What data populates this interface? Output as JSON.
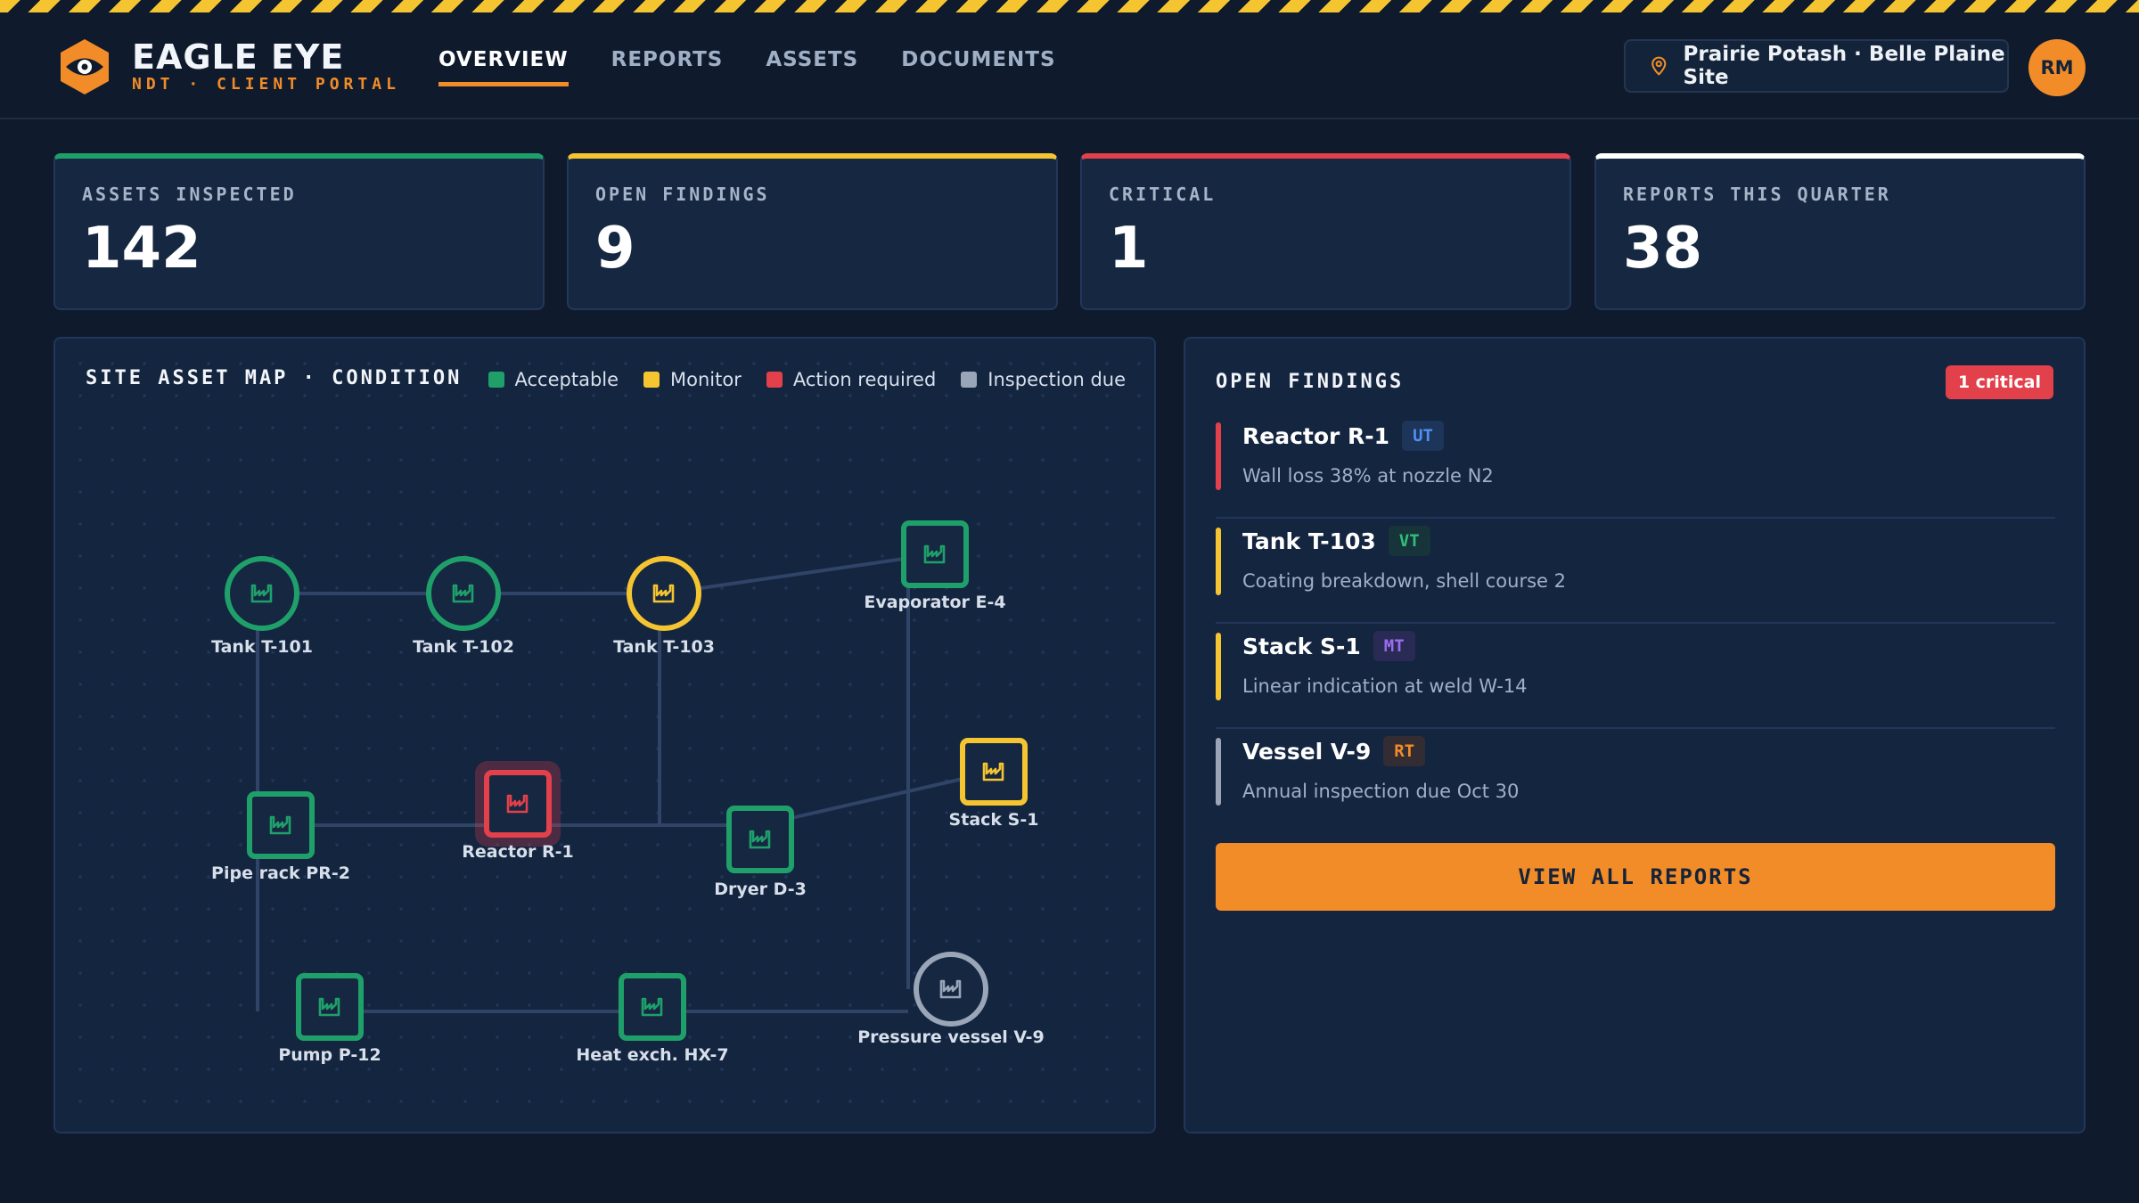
{
  "brand": {
    "name": "EAGLE EYE",
    "subtitle": "NDT · CLIENT PORTAL"
  },
  "nav": {
    "tabs": [
      {
        "label": "OVERVIEW",
        "active": true
      },
      {
        "label": "REPORTS",
        "active": false
      },
      {
        "label": "ASSETS",
        "active": false
      },
      {
        "label": "DOCUMENTS",
        "active": false
      }
    ]
  },
  "site": {
    "label": "Prairie Potash · Belle Plaine Site",
    "icon": "map-pin-icon"
  },
  "user": {
    "initials": "RM"
  },
  "colors": {
    "accent": "#f28c28",
    "acceptable": "#1fa06a",
    "monitor": "#f5c431",
    "action": "#e2404a",
    "due": "#9aa6b8",
    "white": "#ffffff"
  },
  "stats": [
    {
      "label": "ASSETS INSPECTED",
      "value": "142",
      "color": "#1fa06a"
    },
    {
      "label": "OPEN FINDINGS",
      "value": "9",
      "color": "#f5c431"
    },
    {
      "label": "CRITICAL",
      "value": "1",
      "color": "#e2404a"
    },
    {
      "label": "REPORTS THIS QUARTER",
      "value": "38",
      "color": "#ffffff"
    }
  ],
  "map": {
    "title": "SITE ASSET MAP · CONDITION",
    "legend": [
      {
        "label": "Acceptable",
        "color": "#1fa06a"
      },
      {
        "label": "Monitor",
        "color": "#f5c431"
      },
      {
        "label": "Action required",
        "color": "#e2404a"
      },
      {
        "label": "Inspection due",
        "color": "#9aa6b8"
      }
    ],
    "assets": [
      {
        "name": "Tank T-101",
        "status": "acceptable",
        "shape": "circle"
      },
      {
        "name": "Tank T-102",
        "status": "acceptable",
        "shape": "circle"
      },
      {
        "name": "Tank T-103",
        "status": "monitor",
        "shape": "circle"
      },
      {
        "name": "Evaporator E-4",
        "status": "acceptable",
        "shape": "square"
      },
      {
        "name": "Pipe rack PR-2",
        "status": "acceptable",
        "shape": "square"
      },
      {
        "name": "Reactor R-1",
        "status": "action",
        "shape": "square"
      },
      {
        "name": "Dryer D-3",
        "status": "acceptable",
        "shape": "square"
      },
      {
        "name": "Stack S-1",
        "status": "monitor",
        "shape": "square"
      },
      {
        "name": "Pump P-12",
        "status": "acceptable",
        "shape": "square"
      },
      {
        "name": "Heat exch. HX-7",
        "status": "acceptable",
        "shape": "square"
      },
      {
        "name": "Pressure vessel V-9",
        "status": "due",
        "shape": "circle"
      }
    ]
  },
  "findings": {
    "title": "OPEN FINDINGS",
    "badge": "1 critical",
    "items": [
      {
        "asset": "Reactor R-1",
        "method": "UT",
        "desc": "Wall loss 38% at nozzle N2",
        "severity": "#e2404a",
        "method_color": "#4f8ff0",
        "method_bg": "#1d3558"
      },
      {
        "asset": "Tank T-103",
        "method": "VT",
        "desc": "Coating breakdown, shell course 2",
        "severity": "#f5c431",
        "method_color": "#2fbf7a",
        "method_bg": "#17343a"
      },
      {
        "asset": "Stack S-1",
        "method": "MT",
        "desc": "Linear indication at weld W-14",
        "severity": "#f5c431",
        "method_color": "#9b6cf0",
        "method_bg": "#2a2b55"
      },
      {
        "asset": "Vessel V-9",
        "method": "RT",
        "desc": "Annual inspection due Oct 30",
        "severity": "#9aa6b8",
        "method_color": "#f28c28",
        "method_bg": "#332c32"
      }
    ],
    "cta": "VIEW ALL REPORTS"
  }
}
